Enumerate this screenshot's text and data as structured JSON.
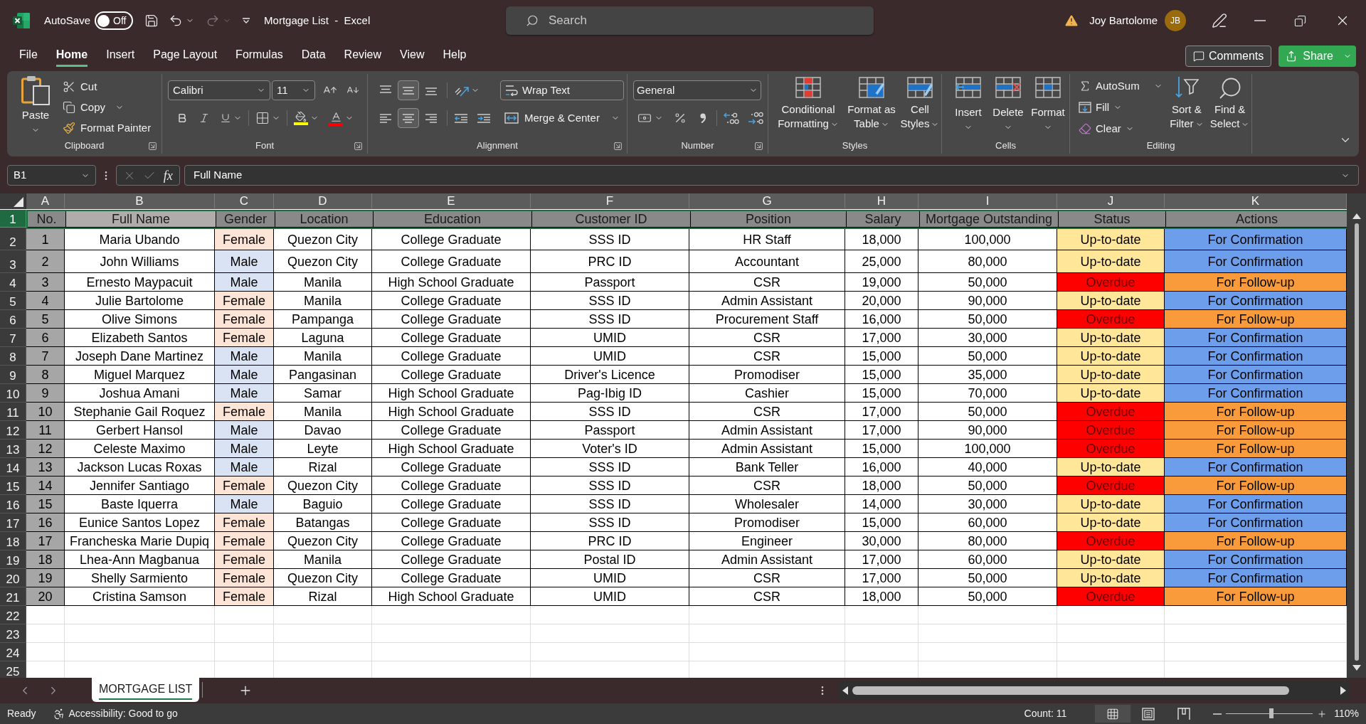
{
  "title_bar": {
    "autosave_label": "AutoSave",
    "autosave_toggle": {
      "on": false,
      "label": "Off"
    },
    "redo": {
      "disabled": true
    },
    "title": "Mortgage List  -  Excel",
    "search": {
      "placeholder": "Search"
    },
    "user_name": "Joy Bartolome",
    "avatar_initials": "JB"
  },
  "ribbon_tabs": [
    {
      "label": "File",
      "selected": false
    },
    {
      "label": "Home",
      "selected": true
    },
    {
      "label": "Insert",
      "selected": false
    },
    {
      "label": "Page Layout",
      "selected": false
    },
    {
      "label": "Formulas",
      "selected": false
    },
    {
      "label": "Data",
      "selected": false
    },
    {
      "label": "Review",
      "selected": false
    },
    {
      "label": "View",
      "selected": false
    },
    {
      "label": "Help",
      "selected": false
    }
  ],
  "comments_button": "Comments",
  "share_button": "Share",
  "ribbon": {
    "clipboard": {
      "paste": "Paste",
      "cut": "Cut",
      "copy": "Copy",
      "format_painter": "Format Painter",
      "group_label": "Clipboard"
    },
    "font": {
      "font_name": "Calibri",
      "font_size": "11",
      "group_label": "Font"
    },
    "alignment": {
      "vertical": [
        {
          "kind": "top",
          "selected": false
        },
        {
          "kind": "middle",
          "selected": true
        },
        {
          "kind": "bottom",
          "selected": false
        }
      ],
      "horizontal": [
        {
          "kind": "left",
          "selected": false
        },
        {
          "kind": "center",
          "selected": true
        },
        {
          "kind": "right",
          "selected": false
        }
      ],
      "wrap_text": "Wrap Text",
      "merge_center": "Merge & Center",
      "group_label": "Alignment"
    },
    "number": {
      "format": "General",
      "group_label": "Number"
    },
    "styles": {
      "buttons": [
        {
          "kind": "conditional",
          "label": "Conditional Formatting"
        },
        {
          "kind": "table",
          "label": "Format as Table"
        },
        {
          "kind": "cell",
          "label": "Cell Styles"
        }
      ],
      "group_label": "Styles"
    },
    "cells": {
      "buttons": [
        {
          "kind": "insert",
          "label": "Insert"
        },
        {
          "kind": "delete",
          "label": "Delete"
        },
        {
          "kind": "format",
          "label": "Format"
        }
      ],
      "group_label": "Cells"
    },
    "editing": {
      "autosum": "AutoSum",
      "fill": "Fill",
      "clear": "Clear",
      "sort_filter": "Sort & Filter",
      "find_select": "Find & Select",
      "group_label": "Editing"
    }
  },
  "formula_bar": {
    "name_box": "B1",
    "cancel": {
      "disabled": true
    },
    "enter": {
      "disabled": true
    },
    "insert_function": "fx",
    "content": "Full Name"
  },
  "sheet": {
    "column_letters": [
      "A",
      "B",
      "C",
      "D",
      "E",
      "F",
      "G",
      "H",
      "I",
      "J",
      "K"
    ],
    "row_numbers": [
      {
        "label": "1",
        "selected": true
      },
      {
        "label": "2",
        "selected": false
      },
      {
        "label": "3",
        "selected": false
      },
      {
        "label": "4",
        "selected": false
      },
      {
        "label": "5",
        "selected": false
      },
      {
        "label": "6",
        "selected": false
      },
      {
        "label": "7",
        "selected": false
      },
      {
        "label": "8",
        "selected": false
      },
      {
        "label": "9",
        "selected": false
      },
      {
        "label": "10",
        "selected": false
      },
      {
        "label": "11",
        "selected": false
      },
      {
        "label": "12",
        "selected": false
      },
      {
        "label": "13",
        "selected": false
      },
      {
        "label": "14",
        "selected": false
      },
      {
        "label": "15",
        "selected": false
      },
      {
        "label": "16",
        "selected": false
      },
      {
        "label": "17",
        "selected": false
      },
      {
        "label": "18",
        "selected": false
      },
      {
        "label": "19",
        "selected": false
      },
      {
        "label": "20",
        "selected": false
      },
      {
        "label": "21",
        "selected": false
      },
      {
        "label": "22",
        "selected": false
      },
      {
        "label": "23",
        "selected": false
      },
      {
        "label": "24",
        "selected": false
      },
      {
        "label": "25",
        "selected": false
      }
    ],
    "table": {
      "columns": [
        {
          "label": "No.",
          "selected": false
        },
        {
          "label": "Full Name",
          "selected": true
        },
        {
          "label": "Gender",
          "selected": false
        },
        {
          "label": "Location",
          "selected": false
        },
        {
          "label": "Education",
          "selected": false
        },
        {
          "label": "Customer ID",
          "selected": false
        },
        {
          "label": "Position",
          "selected": false
        },
        {
          "label": "Salary",
          "selected": false
        },
        {
          "label": "Mortgage Outstanding",
          "selected": false
        },
        {
          "label": "Status",
          "selected": false
        },
        {
          "label": "Actions",
          "selected": false
        }
      ],
      "rows": [
        {
          "no": "1",
          "full_name": "Maria Ubando",
          "gender": {
            "text": "Female",
            "color": "#fce4d6"
          },
          "location": "Quezon City",
          "education": "College Graduate",
          "customer_id": "SSS ID",
          "position": "HR Staff",
          "salary": "18,000",
          "mortgage_outstanding": "100,000",
          "status": {
            "text": "Up-to-date",
            "kind": "up_to_date",
            "color": "#ffe699"
          },
          "action": {
            "text": "For Confirmation",
            "color": "#6d9eeb"
          }
        },
        {
          "no": "2",
          "full_name": "John Williams",
          "gender": {
            "text": "Male",
            "color": "#dae3f3"
          },
          "location": "Quezon City",
          "education": "College Graduate",
          "customer_id": "PRC ID",
          "position": "Accountant",
          "salary": "25,000",
          "mortgage_outstanding": "80,000",
          "status": {
            "text": "Up-to-date",
            "kind": "up_to_date",
            "color": "#ffe699"
          },
          "action": {
            "text": "For Confirmation",
            "color": "#6d9eeb"
          }
        },
        {
          "no": "3",
          "full_name": "Ernesto Maypacuit",
          "gender": {
            "text": "Male",
            "color": "#dae3f3"
          },
          "location": "Manila",
          "education": "High School Graduate",
          "customer_id": "Passport",
          "position": "CSR",
          "salary": "19,000",
          "mortgage_outstanding": "50,000",
          "status": {
            "text": "Overdue",
            "kind": "overdue",
            "color": "#ff0000"
          },
          "action": {
            "text": "For Follow-up",
            "color": "#fa9b3b"
          }
        },
        {
          "no": "4",
          "full_name": "Julie Bartolome",
          "gender": {
            "text": "Female",
            "color": "#fce4d6"
          },
          "location": "Manila",
          "education": "College Graduate",
          "customer_id": "SSS ID",
          "position": "Admin Assistant",
          "salary": "20,000",
          "mortgage_outstanding": "90,000",
          "status": {
            "text": "Up-to-date",
            "kind": "up_to_date",
            "color": "#ffe699"
          },
          "action": {
            "text": "For Confirmation",
            "color": "#6d9eeb"
          }
        },
        {
          "no": "5",
          "full_name": "Olive Simons",
          "gender": {
            "text": "Female",
            "color": "#fce4d6"
          },
          "location": "Pampanga",
          "education": "College Graduate",
          "customer_id": "SSS ID",
          "position": "Procurement Staff",
          "salary": "16,000",
          "mortgage_outstanding": "50,000",
          "status": {
            "text": "Overdue",
            "kind": "overdue",
            "color": "#ff0000"
          },
          "action": {
            "text": "For Follow-up",
            "color": "#fa9b3b"
          }
        },
        {
          "no": "6",
          "full_name": "Elizabeth Santos",
          "gender": {
            "text": "Female",
            "color": "#fce4d6"
          },
          "location": "Laguna",
          "education": "College Graduate",
          "customer_id": "UMID",
          "position": "CSR",
          "salary": "17,000",
          "mortgage_outstanding": "30,000",
          "status": {
            "text": "Up-to-date",
            "kind": "up_to_date",
            "color": "#ffe699"
          },
          "action": {
            "text": "For Confirmation",
            "color": "#6d9eeb"
          }
        },
        {
          "no": "7",
          "full_name": "Joseph Dane Martinez",
          "gender": {
            "text": "Male",
            "color": "#dae3f3"
          },
          "location": "Manila",
          "education": "College Graduate",
          "customer_id": "UMID",
          "position": "CSR",
          "salary": "15,000",
          "mortgage_outstanding": "50,000",
          "status": {
            "text": "Up-to-date",
            "kind": "up_to_date",
            "color": "#ffe699"
          },
          "action": {
            "text": "For Confirmation",
            "color": "#6d9eeb"
          }
        },
        {
          "no": "8",
          "full_name": "Miguel Marquez",
          "gender": {
            "text": "Male",
            "color": "#dae3f3"
          },
          "location": "Pangasinan",
          "education": "College Graduate",
          "customer_id": "Driver's Licence",
          "position": "Promodiser",
          "salary": "15,000",
          "mortgage_outstanding": "35,000",
          "status": {
            "text": "Up-to-date",
            "kind": "up_to_date",
            "color": "#ffe699"
          },
          "action": {
            "text": "For Confirmation",
            "color": "#6d9eeb"
          }
        },
        {
          "no": "9",
          "full_name": "Joshua Amani",
          "gender": {
            "text": "Male",
            "color": "#dae3f3"
          },
          "location": "Samar",
          "education": "High School Graduate",
          "customer_id": "Pag-Ibig ID",
          "position": "Cashier",
          "salary": "15,000",
          "mortgage_outstanding": "70,000",
          "status": {
            "text": "Up-to-date",
            "kind": "up_to_date",
            "color": "#ffe699"
          },
          "action": {
            "text": "For Confirmation",
            "color": "#6d9eeb"
          }
        },
        {
          "no": "10",
          "full_name": "Stephanie Gail Roquez",
          "gender": {
            "text": "Female",
            "color": "#fce4d6"
          },
          "location": "Manila",
          "education": "High School Graduate",
          "customer_id": "SSS ID",
          "position": "CSR",
          "salary": "17,000",
          "mortgage_outstanding": "50,000",
          "status": {
            "text": "Overdue",
            "kind": "overdue",
            "color": "#ff0000"
          },
          "action": {
            "text": "For Follow-up",
            "color": "#fa9b3b"
          }
        },
        {
          "no": "11",
          "full_name": "Gerbert Hansol",
          "gender": {
            "text": "Male",
            "color": "#dae3f3"
          },
          "location": "Davao",
          "education": "College Graduate",
          "customer_id": "Passport",
          "position": "Admin Assistant",
          "salary": "17,000",
          "mortgage_outstanding": "90,000",
          "status": {
            "text": "Overdue",
            "kind": "overdue",
            "color": "#ff0000"
          },
          "action": {
            "text": "For Follow-up",
            "color": "#fa9b3b"
          }
        },
        {
          "no": "12",
          "full_name": "Celeste Maximo",
          "gender": {
            "text": "Male",
            "color": "#dae3f3"
          },
          "location": "Leyte",
          "education": "High School Graduate",
          "customer_id": "Voter's ID",
          "position": "Admin Assistant",
          "salary": "15,000",
          "mortgage_outstanding": "100,000",
          "status": {
            "text": "Overdue",
            "kind": "overdue",
            "color": "#ff0000"
          },
          "action": {
            "text": "For Follow-up",
            "color": "#fa9b3b"
          }
        },
        {
          "no": "13",
          "full_name": "Jackson Lucas Roxas",
          "gender": {
            "text": "Male",
            "color": "#dae3f3"
          },
          "location": "Rizal",
          "education": "College Graduate",
          "customer_id": "SSS ID",
          "position": "Bank Teller",
          "salary": "16,000",
          "mortgage_outstanding": "40,000",
          "status": {
            "text": "Up-to-date",
            "kind": "up_to_date",
            "color": "#ffe699"
          },
          "action": {
            "text": "For Confirmation",
            "color": "#6d9eeb"
          }
        },
        {
          "no": "14",
          "full_name": "Jennifer Santiago",
          "gender": {
            "text": "Female",
            "color": "#fce4d6"
          },
          "location": "Quezon City",
          "education": "College Graduate",
          "customer_id": "SSS ID",
          "position": "CSR",
          "salary": "18,000",
          "mortgage_outstanding": "50,000",
          "status": {
            "text": "Overdue",
            "kind": "overdue",
            "color": "#ff0000"
          },
          "action": {
            "text": "For Follow-up",
            "color": "#fa9b3b"
          }
        },
        {
          "no": "15",
          "full_name": "Baste Iquerra",
          "gender": {
            "text": "Male",
            "color": "#dae3f3"
          },
          "location": "Baguio",
          "education": "College Graduate",
          "customer_id": "SSS ID",
          "position": "Wholesaler",
          "salary": "14,000",
          "mortgage_outstanding": "30,000",
          "status": {
            "text": "Up-to-date",
            "kind": "up_to_date",
            "color": "#ffe699"
          },
          "action": {
            "text": "For Confirmation",
            "color": "#6d9eeb"
          }
        },
        {
          "no": "16",
          "full_name": "Eunice Santos Lopez",
          "gender": {
            "text": "Female",
            "color": "#fce4d6"
          },
          "location": "Batangas",
          "education": "College Graduate",
          "customer_id": "SSS ID",
          "position": "Promodiser",
          "salary": "15,000",
          "mortgage_outstanding": "60,000",
          "status": {
            "text": "Up-to-date",
            "kind": "up_to_date",
            "color": "#ffe699"
          },
          "action": {
            "text": "For Confirmation",
            "color": "#6d9eeb"
          }
        },
        {
          "no": "17",
          "full_name": "Francheska Marie Dupiq",
          "gender": {
            "text": "Female",
            "color": "#fce4d6"
          },
          "location": "Quezon City",
          "education": "College Graduate",
          "customer_id": "PRC ID",
          "position": "Engineer",
          "salary": "30,000",
          "mortgage_outstanding": "80,000",
          "status": {
            "text": "Overdue",
            "kind": "overdue",
            "color": "#ff0000"
          },
          "action": {
            "text": "For Follow-up",
            "color": "#fa9b3b"
          }
        },
        {
          "no": "18",
          "full_name": "Lhea-Ann Magbanua",
          "gender": {
            "text": "Female",
            "color": "#fce4d6"
          },
          "location": "Manila",
          "education": "College Graduate",
          "customer_id": "Postal ID",
          "position": "Admin Assistant",
          "salary": "17,000",
          "mortgage_outstanding": "60,000",
          "status": {
            "text": "Up-to-date",
            "kind": "up_to_date",
            "color": "#ffe699"
          },
          "action": {
            "text": "For Confirmation",
            "color": "#6d9eeb"
          }
        },
        {
          "no": "19",
          "full_name": "Shelly Sarmiento",
          "gender": {
            "text": "Female",
            "color": "#fce4d6"
          },
          "location": "Quezon City",
          "education": "College Graduate",
          "customer_id": "UMID",
          "position": "CSR",
          "salary": "17,000",
          "mortgage_outstanding": "50,000",
          "status": {
            "text": "Up-to-date",
            "kind": "up_to_date",
            "color": "#ffe699"
          },
          "action": {
            "text": "For Confirmation",
            "color": "#6d9eeb"
          }
        },
        {
          "no": "20",
          "full_name": "Cristina Samson",
          "gender": {
            "text": "Female",
            "color": "#fce4d6"
          },
          "location": "Rizal",
          "education": "High School Graduate",
          "customer_id": "UMID",
          "position": "CSR",
          "salary": "18,000",
          "mortgage_outstanding": "50,000",
          "status": {
            "text": "Overdue",
            "kind": "overdue",
            "color": "#ff0000"
          },
          "action": {
            "text": "For Follow-up",
            "color": "#fa9b3b"
          }
        }
      ]
    }
  },
  "sheet_tabs": [
    {
      "label": "MORTGAGE LIST",
      "selected": true
    }
  ],
  "status_bar": {
    "ready": "Ready",
    "accessibility": "Accessibility: Good to go",
    "count": "Count: 11",
    "views": [
      {
        "kind": "normal",
        "selected": true
      },
      {
        "kind": "page_layout",
        "selected": false
      },
      {
        "kind": "page_break",
        "selected": false
      }
    ],
    "zoom": {
      "level": 0.52,
      "reading": "110%"
    }
  }
}
